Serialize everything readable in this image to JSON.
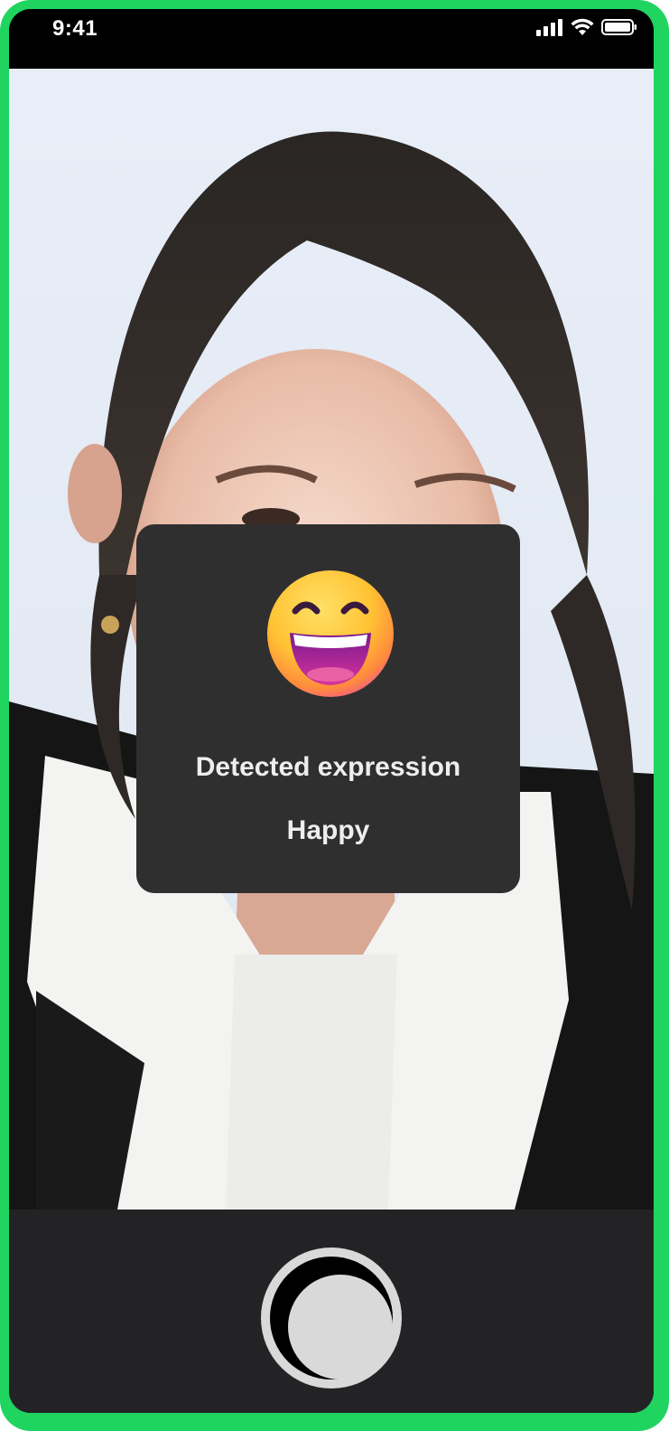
{
  "status_bar": {
    "time": "9:41",
    "icons": [
      "cellular-signal-icon",
      "wifi-icon",
      "battery-icon"
    ]
  },
  "expression_card": {
    "emoji_icon": "grinning-face-with-smiling-eyes-icon",
    "label": "Detected expression",
    "value": "Happy"
  },
  "camera": {
    "shutter_icon": "shutter-button-icon"
  },
  "colors": {
    "frame_border": "#20d460",
    "card_background": "#2f2f2f",
    "bottom_bar": "#262628",
    "shutter": "#d9d9d9"
  }
}
